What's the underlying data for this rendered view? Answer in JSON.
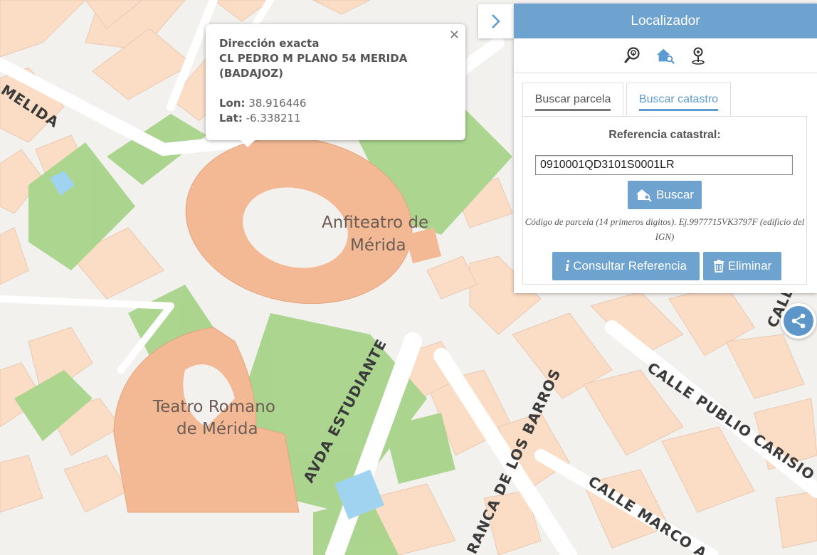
{
  "map": {
    "labels": {
      "anfiteatro_1": "Anfiteatro de",
      "anfiteatro_2": "Mérida",
      "teatro_1": "Teatro Romano",
      "teatro_2": "de Mérida",
      "merida_street": "MELIDA",
      "avda_estudiante": "AVDA ESTUDIANTE",
      "calle_publio": "CALLE PUBLIO CARISIO",
      "calle_marco": "CALLE MARCO A",
      "barros": "RANCA DE LOS BARROS",
      "calle_corner": "CALL"
    },
    "colors": {
      "background": "#f3f1ee",
      "block": "#fbdcc5",
      "monument": "#f3b994",
      "park": "#a8d48a",
      "water": "#9fd3ef"
    }
  },
  "popup": {
    "title": "Dirección exacta",
    "address": "CL PEDRO M PLANO 54 MERIDA (BADAJOZ)",
    "lon_label": "Lon:",
    "lon_value": "38.916446",
    "lat_label": "Lat:",
    "lat_value": "-6.338211",
    "close_icon": "×"
  },
  "panel": {
    "title": "Localizador",
    "toggle_icon": "chevron-right-icon",
    "tool_icons": [
      "map-search-icon",
      "house-search-icon",
      "location-pin-icon"
    ],
    "tabs": [
      {
        "label": "Buscar parcela",
        "active": false
      },
      {
        "label": "Buscar catastro",
        "active": true
      }
    ],
    "field_label": "Referencia catastral:",
    "field_value": "0910001QD3101S0001LR",
    "search_button": "Buscar",
    "hint": "Código de parcela (14 primeros digitos). Ej.9977715VK3797F (edificio del IGN)",
    "consult_button": "Consultar Referencia",
    "delete_button": "Eliminar",
    "accent": "#6fa3cf"
  },
  "share": {
    "icon": "share-icon"
  }
}
